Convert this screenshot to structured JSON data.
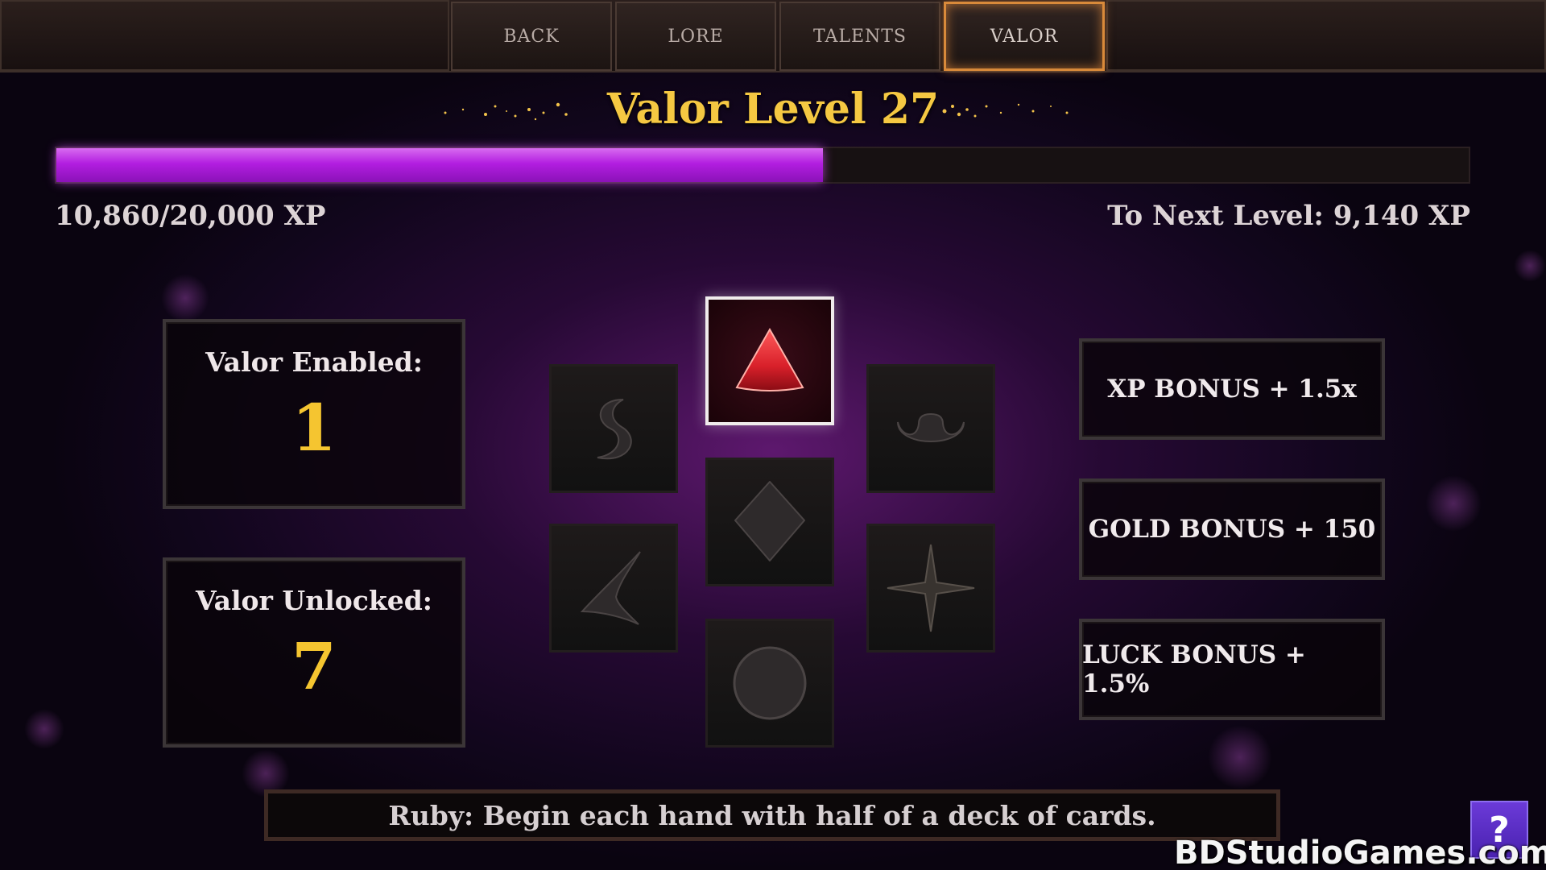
{
  "tabs": [
    {
      "label": "BACK"
    },
    {
      "label": "LORE"
    },
    {
      "label": "TALENTS"
    },
    {
      "label": "VALOR",
      "active": true
    }
  ],
  "title": "Valor Level 27",
  "xp": {
    "current_text": "10,860/20,000 XP",
    "next_text": "To Next Level: 9,140 XP",
    "current": 10860,
    "max": 20000
  },
  "stats": {
    "enabled_label": "Valor Enabled:",
    "enabled_value": "1",
    "unlocked_label": "Valor Unlocked:",
    "unlocked_value": "7"
  },
  "gems": [
    {
      "name": "ruby",
      "icon": "triangle-gem-icon",
      "color": "#d8202a",
      "selected": true
    },
    {
      "name": "s-curve",
      "icon": "s-curve-gem-icon",
      "selected": false
    },
    {
      "name": "crescent",
      "icon": "crescent-gem-icon",
      "selected": false
    },
    {
      "name": "diamond",
      "icon": "diamond-gem-icon",
      "selected": false
    },
    {
      "name": "chevron",
      "icon": "chevron-gem-icon",
      "selected": false
    },
    {
      "name": "star",
      "icon": "four-point-star-gem-icon",
      "selected": false
    },
    {
      "name": "circle",
      "icon": "circle-gem-icon",
      "selected": false
    }
  ],
  "bonuses": [
    {
      "label": "XP BONUS + 1.5x"
    },
    {
      "label": "GOLD BONUS + 150"
    },
    {
      "label": "LUCK BONUS + 1.5%"
    }
  ],
  "description": "Ruby: Begin each hand with half of a deck of cards.",
  "help_label": "?",
  "watermark": "BDStudioGames.com",
  "colors": {
    "accent_gold": "#f5c842",
    "xp_purple": "#b21ee0",
    "active_tab_border": "#d98a3a"
  }
}
